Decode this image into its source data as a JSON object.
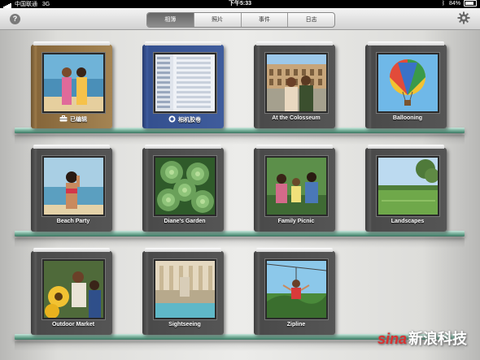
{
  "status_bar": {
    "carrier": "中国联通",
    "network": "3G",
    "time": "下午5:33",
    "battery": "84%",
    "battery_level": 0.84
  },
  "toolbar": {
    "help_symbol": "?",
    "tabs": [
      {
        "label": "相簿",
        "active": true
      },
      {
        "label": "照片",
        "active": false
      },
      {
        "label": "事件",
        "active": false
      },
      {
        "label": "日志",
        "active": false
      }
    ]
  },
  "albums": [
    {
      "title": "已编辑",
      "icon": "briefcase-icon",
      "cover": "wood",
      "photo": "two-women-beach"
    },
    {
      "title": "相机胶卷",
      "icon": "camera-icon",
      "cover": "blue",
      "photo": "settings-screenshot"
    },
    {
      "title": "At the Colosseum",
      "cover": "gray",
      "photo": "couple-colosseum"
    },
    {
      "title": "Ballooning",
      "cover": "gray",
      "photo": "hot-air-balloon"
    },
    {
      "title": "Beach Party",
      "cover": "gray",
      "photo": "woman-beach"
    },
    {
      "title": "Diane's Garden",
      "cover": "gray",
      "photo": "succulents"
    },
    {
      "title": "Family Picnic",
      "cover": "gray",
      "photo": "family"
    },
    {
      "title": "Landscapes",
      "cover": "gray",
      "photo": "green-field"
    },
    {
      "title": "Outdoor Market",
      "cover": "gray",
      "photo": "sunflowers"
    },
    {
      "title": "Sightseeing",
      "cover": "gray",
      "photo": "trevi-fountain"
    },
    {
      "title": "Zipline",
      "cover": "gray",
      "photo": "zipline"
    }
  ],
  "watermark": {
    "brand": "sina",
    "text": "新浪科技"
  },
  "colors": {
    "shelf": "#78b09b",
    "status_bg": "#000000",
    "active_tab": "#6f6f6f"
  }
}
